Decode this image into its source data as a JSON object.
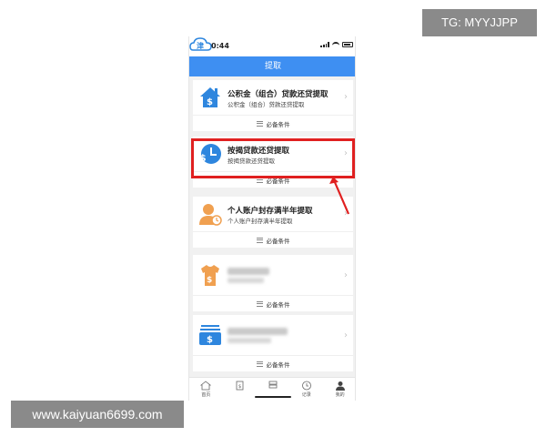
{
  "overlays": {
    "tg_label": "TG: MYYJJPP",
    "url_label": "www.kaiyuan6699.com"
  },
  "status_bar": {
    "time": "0:44"
  },
  "nav": {
    "title": "提取"
  },
  "cards": [
    {
      "title": "公积金（组合）贷款还贷提取",
      "subtitle": "公积金（组合）贷款还贷提取",
      "footer": "必备条件",
      "icon": "house-dollar-icon"
    },
    {
      "title": "按揭贷款还贷提取",
      "subtitle": "按揭贷款还贷提取",
      "footer": "必备条件",
      "icon": "dollar-clock-icon"
    },
    {
      "title": "个人账户封存满半年提取",
      "subtitle": "个人账户封存满半年提取",
      "footer": "必备条件",
      "icon": "person-clock-icon"
    },
    {
      "title": "",
      "subtitle": "",
      "footer": "必备条件",
      "icon": "shirt-dollar-icon",
      "blurred": true
    },
    {
      "title": "",
      "subtitle": "",
      "footer": "必备条件",
      "icon": "card-dollar-icon",
      "blurred": true
    }
  ],
  "tabbar": {
    "items": [
      {
        "label": "首页",
        "icon": "home-icon"
      },
      {
        "label": "",
        "icon": "document-icon"
      },
      {
        "label": "",
        "icon": "stack-icon"
      },
      {
        "label": "记录",
        "icon": "clock-icon"
      },
      {
        "label": "我的",
        "icon": "person-icon"
      }
    ]
  },
  "colors": {
    "nav_blue": "#3e8ff2",
    "icon_blue": "#2e86de",
    "icon_orange": "#f0a050",
    "highlight_red": "#e02020"
  }
}
